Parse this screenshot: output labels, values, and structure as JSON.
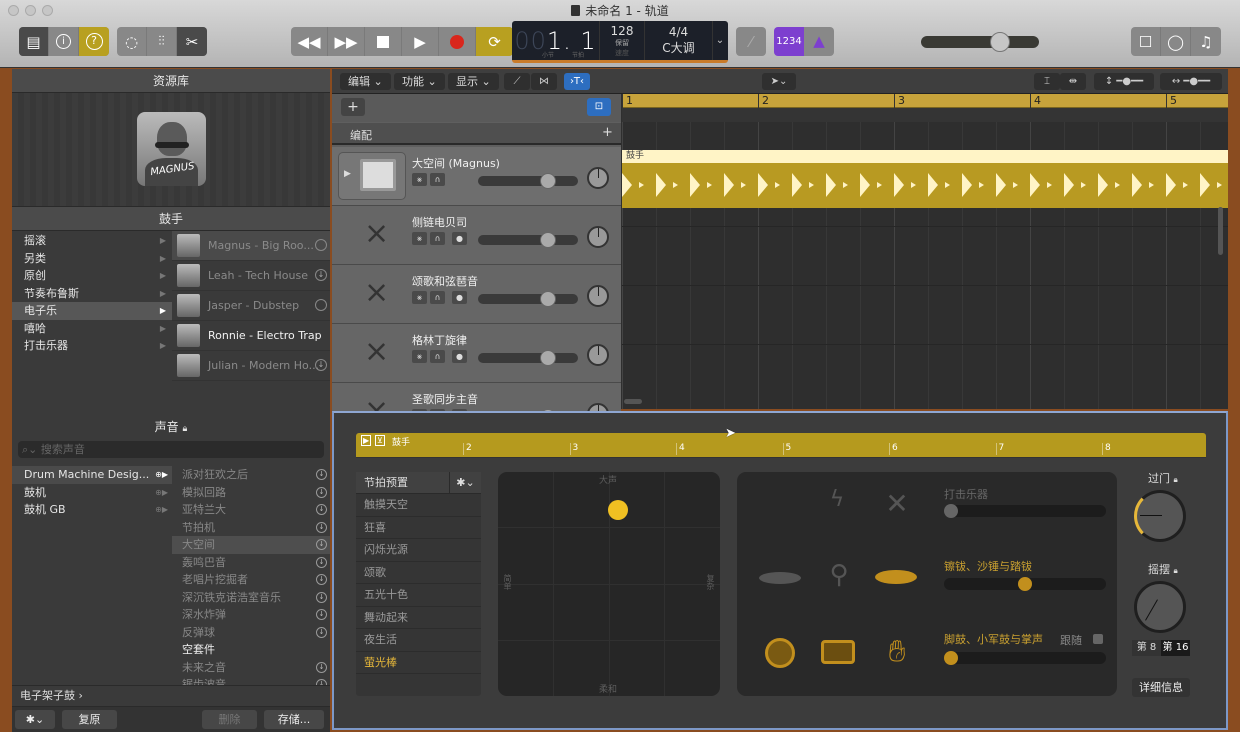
{
  "window": {
    "title": "未命名 1 - 轨道"
  },
  "toolbar": {
    "left_buttons": [
      {
        "icon": "library-icon",
        "active": true
      },
      {
        "icon": "info-icon",
        "active": false
      },
      {
        "icon": "help-icon",
        "active": true
      }
    ],
    "edit_buttons": [
      {
        "icon": "smart-controls-icon"
      },
      {
        "icon": "mixer-icon"
      },
      {
        "icon": "scissors-icon"
      }
    ],
    "transport": [
      {
        "icon": "rewind-icon"
      },
      {
        "icon": "fast-forward-icon"
      },
      {
        "icon": "stop-icon"
      },
      {
        "icon": "play-icon"
      },
      {
        "icon": "record-icon"
      },
      {
        "icon": "cycle-icon",
        "active": true
      }
    ],
    "lcd": {
      "bar_dim": "00",
      "position": "1. 1",
      "bar_label": "小节",
      "beat_label": "节拍",
      "tempo": "128",
      "tempo_mode": "保留",
      "tempo_label": "速度",
      "time_signature": "4/4",
      "key": "C大调"
    },
    "count_in": "1234",
    "metronome_icon": "metronome-icon",
    "master_volume_percent": 70,
    "right_buttons": [
      {
        "icon": "notepad-icon"
      },
      {
        "icon": "loop-browser-icon"
      },
      {
        "icon": "media-browser-icon"
      }
    ]
  },
  "library": {
    "header": "资源库",
    "drummer_header": "鼓手",
    "avatar_signature": "MAGNUS",
    "genres": [
      {
        "label": "摇滚",
        "selected": false
      },
      {
        "label": "另类",
        "selected": false
      },
      {
        "label": "原创",
        "selected": false
      },
      {
        "label": "节奏布鲁斯",
        "selected": false
      },
      {
        "label": "电子乐",
        "selected": true
      },
      {
        "label": "嘻哈",
        "selected": false
      },
      {
        "label": "打击乐器",
        "selected": false
      }
    ],
    "drummers": [
      {
        "name": "Magnus - Big Roo...",
        "status": "selected",
        "highlight": false
      },
      {
        "name": "Leah - Tech House",
        "status": "download",
        "highlight": false
      },
      {
        "name": "Jasper - Dubstep",
        "status": "none",
        "highlight": false
      },
      {
        "name": "Ronnie - Electro Trap",
        "status": "",
        "highlight": true
      },
      {
        "name": "Julian - Modern Ho...",
        "status": "download",
        "highlight": false
      }
    ],
    "sounds_header": "声音",
    "search_placeholder": "搜索声音",
    "kits": [
      {
        "label": "Drum Machine Desig...",
        "selected": true
      },
      {
        "label": "鼓机",
        "selected": false
      },
      {
        "label": "鼓机 GB",
        "selected": false
      }
    ],
    "patches": [
      {
        "label": "派对狂欢之后",
        "hi": false,
        "sel": false,
        "dl": true
      },
      {
        "label": "模拟回路",
        "hi": false,
        "sel": false,
        "dl": true
      },
      {
        "label": "亚特兰大",
        "hi": false,
        "sel": false,
        "dl": true
      },
      {
        "label": "节拍机",
        "hi": false,
        "sel": false,
        "dl": true
      },
      {
        "label": "大空间",
        "hi": false,
        "sel": true,
        "dl": true
      },
      {
        "label": "轰鸣巴音",
        "hi": false,
        "sel": false,
        "dl": true
      },
      {
        "label": "老唱片挖掘者",
        "hi": false,
        "sel": false,
        "dl": true
      },
      {
        "label": "深沉铁克诺浩室音乐",
        "hi": false,
        "sel": false,
        "dl": true
      },
      {
        "label": "深水炸弹",
        "hi": false,
        "sel": false,
        "dl": true
      },
      {
        "label": "反弹球",
        "hi": false,
        "sel": false,
        "dl": true
      },
      {
        "label": "空套件",
        "hi": true,
        "sel": false,
        "dl": false
      },
      {
        "label": "未来之音",
        "hi": false,
        "sel": false,
        "dl": true
      },
      {
        "label": "锯齿波音",
        "hi": false,
        "sel": false,
        "dl": true
      }
    ],
    "breadcrumb": "电子架子鼓 ›",
    "buttons": {
      "revert": "复原",
      "delete": "删除",
      "save": "存储..."
    }
  },
  "tracks": {
    "menus": [
      "编辑",
      "功能",
      "显示"
    ],
    "arrangement_label": "编配",
    "list": [
      {
        "name": "大空间 (Magnus)",
        "type": "drummer"
      },
      {
        "name": "侧链电贝司",
        "type": "keyboard"
      },
      {
        "name": "颂歌和弦琶音",
        "type": "keyboard"
      },
      {
        "name": "格林丁旋律",
        "type": "keyboard"
      },
      {
        "name": "圣歌同步主音",
        "type": "keyboard"
      }
    ],
    "ruler_bars": [
      "1",
      "2",
      "3",
      "4",
      "5"
    ],
    "region_name": "鼓手"
  },
  "editor": {
    "region_name": "鼓手",
    "ruler_bars": [
      "2",
      "3",
      "4",
      "5",
      "6",
      "7",
      "8"
    ],
    "presets_header": "节拍预置",
    "presets": [
      {
        "label": "触摸天空",
        "active": false
      },
      {
        "label": "狂喜",
        "active": false
      },
      {
        "label": "闪烁光源",
        "active": false
      },
      {
        "label": "颂歌",
        "active": false
      },
      {
        "label": "五光十色",
        "active": false
      },
      {
        "label": "舞动起来",
        "active": false
      },
      {
        "label": "夜生活",
        "active": false
      },
      {
        "label": "萤光棒",
        "active": true
      }
    ],
    "xy_pad": {
      "top_label": "大声",
      "bottom_label": "柔和",
      "left_label": "简单",
      "right_label": "复杂",
      "x_complexity": 0.54,
      "y_loudness": 0.92
    },
    "instruments": {
      "percussion_label": "打击乐器",
      "percussion_value": 0,
      "cymbals_label": "镲钹、沙锤与踏钹",
      "cymbals_value": 0.5,
      "kick_label": "脚鼓、小军鼓与掌声",
      "kick_value": 0,
      "follow_label": "跟随"
    },
    "fills_label": "过门",
    "fills_value": 0.15,
    "swing_label": "摇摆",
    "swing_value": 0.55,
    "swing_options": [
      "第 8",
      "第 16"
    ],
    "swing_selected": "第 16",
    "details_button": "详细信息"
  },
  "colors": {
    "accent_gold": "#e7b83a",
    "region_gold": "#b89a22",
    "ruler_gold": "#c7a33b",
    "record_red": "#d9261c",
    "purple": "#7d3fcf",
    "blue": "#2d6ec0"
  }
}
